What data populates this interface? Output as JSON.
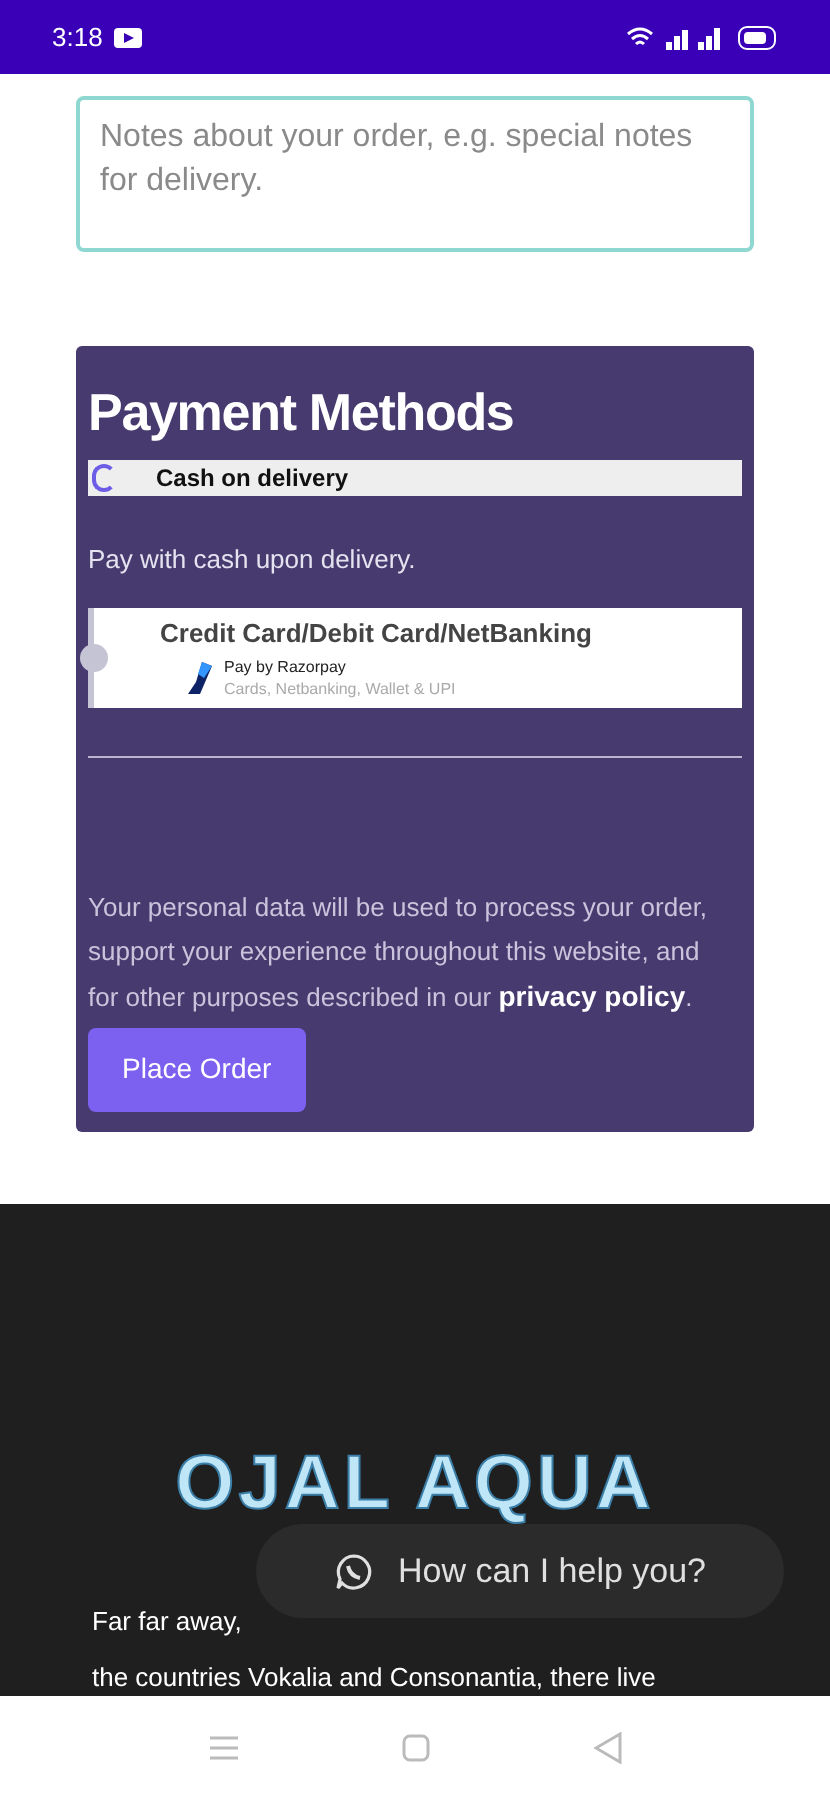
{
  "status_bar": {
    "time": "3:18"
  },
  "order_notes": {
    "placeholder": "Notes about your order, e.g. special notes for delivery."
  },
  "payment": {
    "title": "Payment Methods",
    "methods": [
      {
        "kind": "cash",
        "label": "Cash on delivery",
        "selected": true,
        "description": "Pay with cash upon delivery."
      },
      {
        "kind": "razorpay",
        "label": "Credit Card/Debit Card/NetBanking",
        "selected": false,
        "provider": "Pay by Razorpay",
        "provider_note": "Cards, Netbanking, Wallet & UPI"
      }
    ],
    "privacy_text": "Your personal data will be used to process your order, support your experience throughout this website, and for other purposes described in our ",
    "privacy_link": "privacy policy",
    "privacy_end": ".",
    "button": "Place Order"
  },
  "footer": {
    "logo": "OJAL AQUA",
    "lines": [
      "Far far away,",
      "the countries Vokalia and Consonantia, there live"
    ],
    "chat": "How can I help you?"
  }
}
